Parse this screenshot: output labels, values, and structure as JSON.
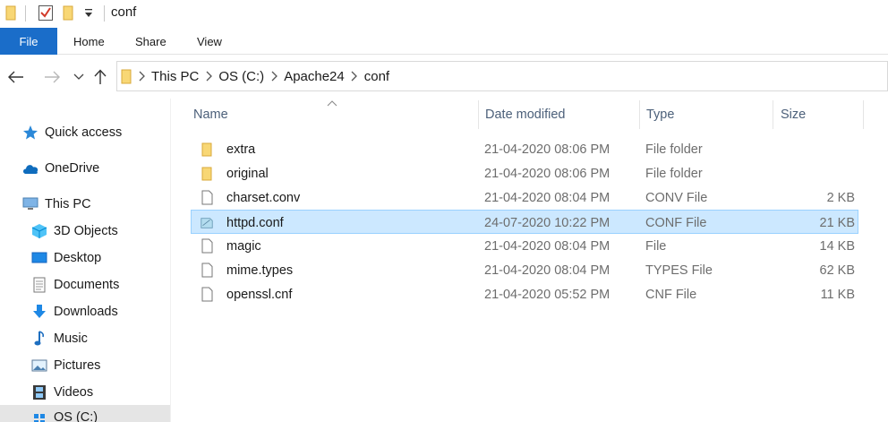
{
  "window": {
    "title": "conf"
  },
  "ribbon": {
    "file_tab": "File",
    "tabs": [
      "Home",
      "Share",
      "View"
    ]
  },
  "nav": {
    "back": "back-arrow-icon",
    "forward": "forward-arrow-icon",
    "recent": "chevron-down-icon",
    "up": "up-arrow-icon"
  },
  "address": {
    "crumbs": [
      "This PC",
      "OS (C:)",
      "Apache24",
      "conf"
    ]
  },
  "sidebar": {
    "items": [
      {
        "label": "Quick access",
        "icon": "star-icon"
      },
      {
        "label": "OneDrive",
        "icon": "cloud-icon"
      },
      {
        "label": "This PC",
        "icon": "computer-icon"
      },
      {
        "label": "3D Objects",
        "icon": "cube-icon"
      },
      {
        "label": "Desktop",
        "icon": "desktop-icon"
      },
      {
        "label": "Documents",
        "icon": "document-icon"
      },
      {
        "label": "Downloads",
        "icon": "download-icon"
      },
      {
        "label": "Music",
        "icon": "music-note-icon"
      },
      {
        "label": "Pictures",
        "icon": "picture-icon"
      },
      {
        "label": "Videos",
        "icon": "film-icon"
      },
      {
        "label": "OS (C:)",
        "icon": "drive-icon"
      }
    ]
  },
  "columns": {
    "name": "Name",
    "date": "Date modified",
    "type": "Type",
    "size": "Size"
  },
  "files": [
    {
      "name": "extra",
      "date": "21-04-2020 08:06 PM",
      "type": "File folder",
      "size": "",
      "icon": "folder-icon"
    },
    {
      "name": "original",
      "date": "21-04-2020 08:06 PM",
      "type": "File folder",
      "size": "",
      "icon": "folder-icon"
    },
    {
      "name": "charset.conv",
      "date": "21-04-2020 08:04 PM",
      "type": "CONV File",
      "size": "2 KB",
      "icon": "file-icon"
    },
    {
      "name": "httpd.conf",
      "date": "24-07-2020 10:22 PM",
      "type": "CONF File",
      "size": "21 KB",
      "icon": "config-file-icon",
      "selected": true
    },
    {
      "name": "magic",
      "date": "21-04-2020 08:04 PM",
      "type": "File",
      "size": "14 KB",
      "icon": "file-icon"
    },
    {
      "name": "mime.types",
      "date": "21-04-2020 08:04 PM",
      "type": "TYPES File",
      "size": "62 KB",
      "icon": "file-icon"
    },
    {
      "name": "openssl.cnf",
      "date": "21-04-2020 05:52 PM",
      "type": "CNF File",
      "size": "11 KB",
      "icon": "file-icon"
    }
  ],
  "colors": {
    "accent": "#1a6dc9",
    "selection_bg": "#cce8ff",
    "selection_border": "#99d1ff",
    "folder": "#f8d775"
  }
}
